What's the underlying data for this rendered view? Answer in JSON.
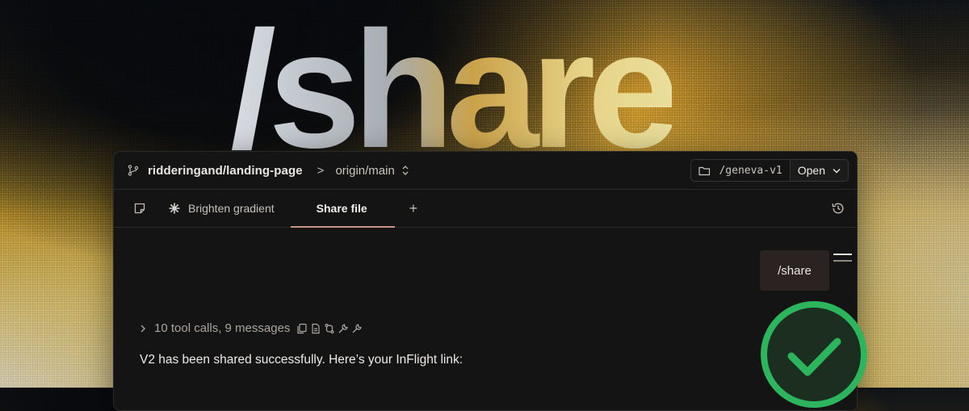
{
  "hero": {
    "text": "/share"
  },
  "window": {
    "topbar": {
      "repo": "ridderingand/landing-page",
      "separator": ">",
      "branch": "origin/main",
      "path": "/geneva-v1",
      "open_button": "Open"
    },
    "tabs": [
      {
        "label": "Brighten gradient",
        "icon": "sparkle-icon",
        "active": false
      },
      {
        "label": "Share file",
        "active": true
      }
    ],
    "add_tab": "+",
    "chat": {
      "user_message": "/share",
      "meta": "10 tool calls, 9 messages",
      "meta_icons": [
        "copy-icon",
        "document-icon",
        "diff-icon",
        "wrench-icon",
        "wrench-icon"
      ],
      "assistant_message": "V2 has been shared successfully. Here’s your InFlight link:"
    }
  },
  "colors": {
    "window_bg": "#151414",
    "active_tab_underline": "#c99282",
    "success_green": "#2db55d"
  }
}
